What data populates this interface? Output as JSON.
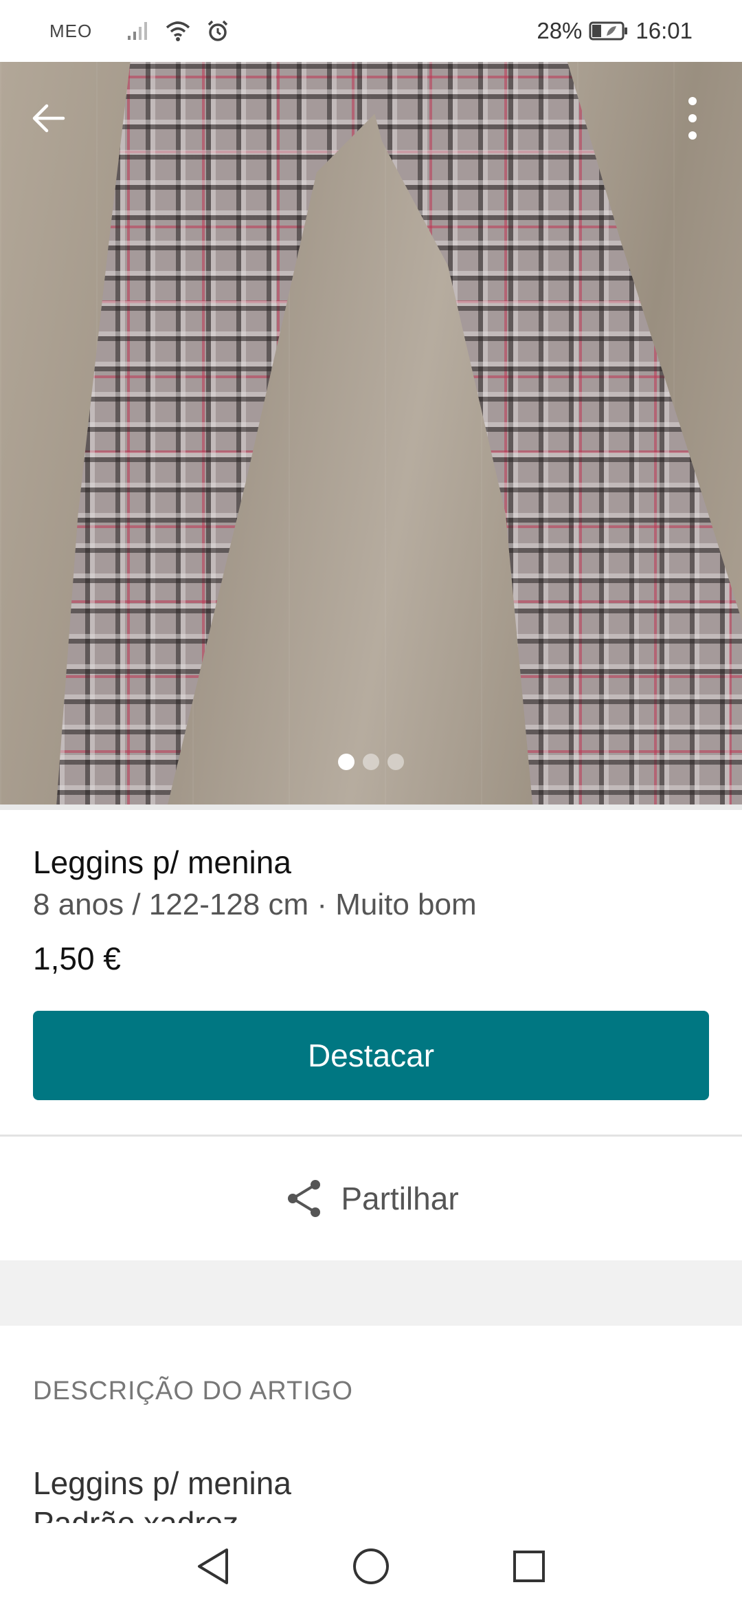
{
  "status_bar": {
    "carrier": "MEO",
    "battery": "28%",
    "time": "16:01",
    "icons": [
      "signal-icon",
      "wifi-icon",
      "alarm-icon",
      "battery-icon"
    ]
  },
  "hero": {
    "image_subject": "plaid leggings photo",
    "image_count": 3,
    "active_image": 1,
    "icons": [
      "back-arrow-icon",
      "more-vertical-icon"
    ]
  },
  "item": {
    "title": "Leggins p/ menina",
    "subtitle": "8 anos / 122-128 cm · Muito bom",
    "price": "1,50 €"
  },
  "actions": {
    "primary_label": "Destacar",
    "share_label": "Partilhar",
    "share_icon": "share-icon"
  },
  "description": {
    "heading": "DESCRIÇÃO DO ARTIGO",
    "lines": [
      "Leggins p/ menina",
      "Padrão xadrez"
    ]
  },
  "nav_bar": {
    "icons": [
      "nav-back-icon",
      "nav-home-icon",
      "nav-recents-icon"
    ]
  },
  "colors": {
    "primary": "#007782",
    "text": "#111111",
    "muted": "#555555",
    "band": "#f1f1f1"
  }
}
